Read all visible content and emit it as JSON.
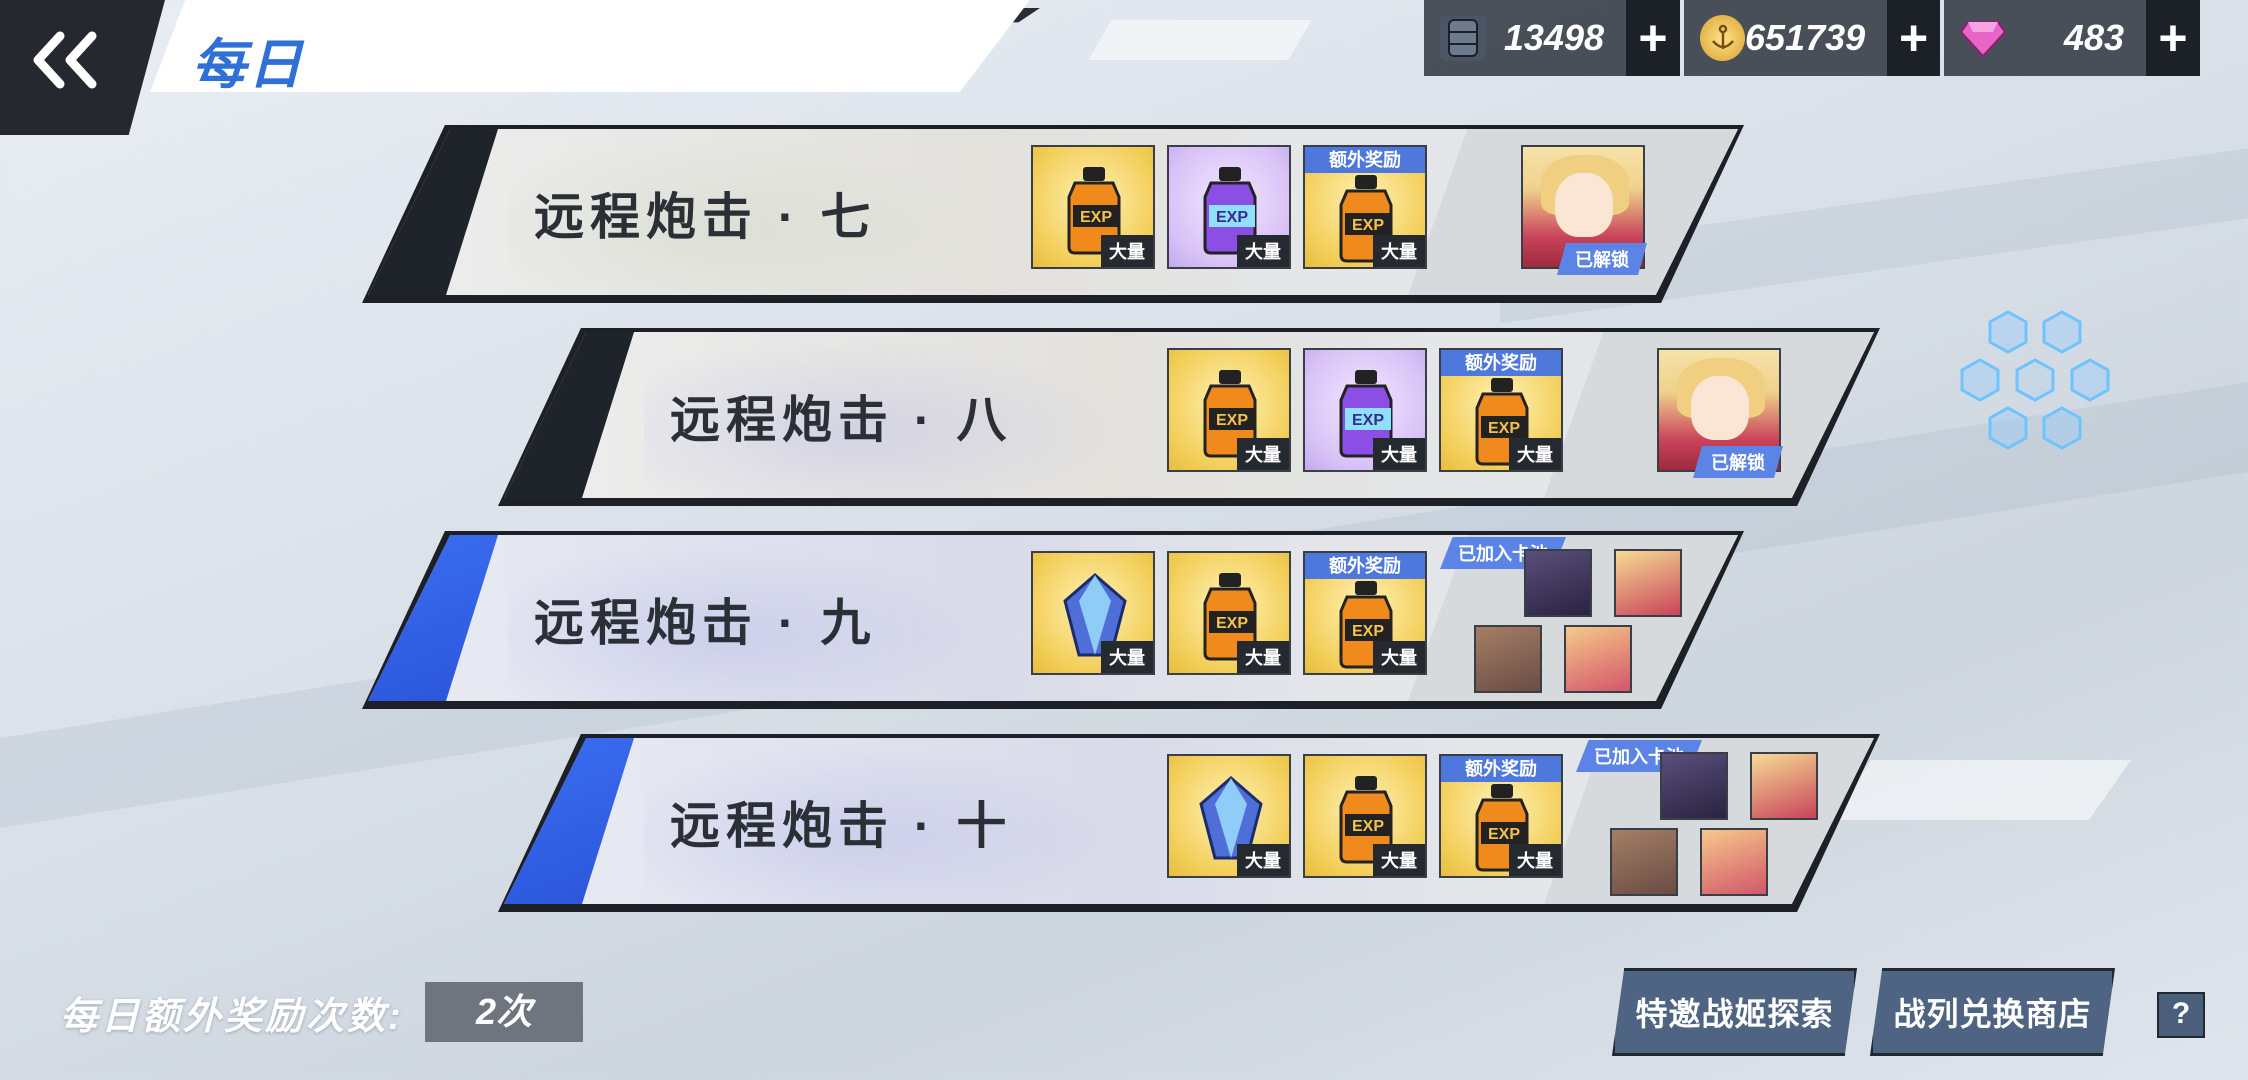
{
  "header": {
    "back_label": "back",
    "title": "每日"
  },
  "currencies": [
    {
      "name": "oil",
      "value": "13498",
      "plus": "+"
    },
    {
      "name": "coins",
      "value": "651739",
      "plus": "+"
    },
    {
      "name": "gems",
      "value": "483",
      "plus": "+"
    }
  ],
  "stages": [
    {
      "title": "远程炮击 · 七",
      "rewards": [
        {
          "item": "orange-bottle",
          "qty": "大量"
        },
        {
          "item": "purple-bottle",
          "qty": "大量"
        },
        {
          "item": "orange-bottle",
          "qty": "大量",
          "bonus": "额外奖励"
        }
      ],
      "status": "已解锁"
    },
    {
      "title": "远程炮击 · 八",
      "rewards": [
        {
          "item": "orange-bottle",
          "qty": "大量"
        },
        {
          "item": "purple-bottle",
          "qty": "大量"
        },
        {
          "item": "orange-bottle",
          "qty": "大量",
          "bonus": "额外奖励"
        }
      ],
      "status": "已解锁"
    },
    {
      "title": "远程炮击 · 九",
      "rewards": [
        {
          "item": "blue-crystal",
          "qty": "大量"
        },
        {
          "item": "orange-bottle",
          "qty": "大量"
        },
        {
          "item": "orange-bottle",
          "qty": "大量",
          "bonus": "额外奖励"
        }
      ],
      "status": "已加入卡池"
    },
    {
      "title": "远程炮击 · 十",
      "rewards": [
        {
          "item": "blue-crystal",
          "qty": "大量"
        },
        {
          "item": "orange-bottle",
          "qty": "大量"
        },
        {
          "item": "orange-bottle",
          "qty": "大量",
          "bonus": "额外奖励"
        }
      ],
      "status": "已加入卡池"
    }
  ],
  "footer": {
    "bonus_label": "每日额外奖励次数:",
    "bonus_count": "2次",
    "btn_explore": "特邀战姬探索",
    "btn_shop": "战列兑换商店",
    "help": "?"
  },
  "colors": {
    "accent_blue": "#3b6ef2",
    "dark": "#1d2127",
    "gold_item": "#f3cf5b",
    "purple_item": "#d8c2f6",
    "tag_blue": "#5b84e6"
  }
}
